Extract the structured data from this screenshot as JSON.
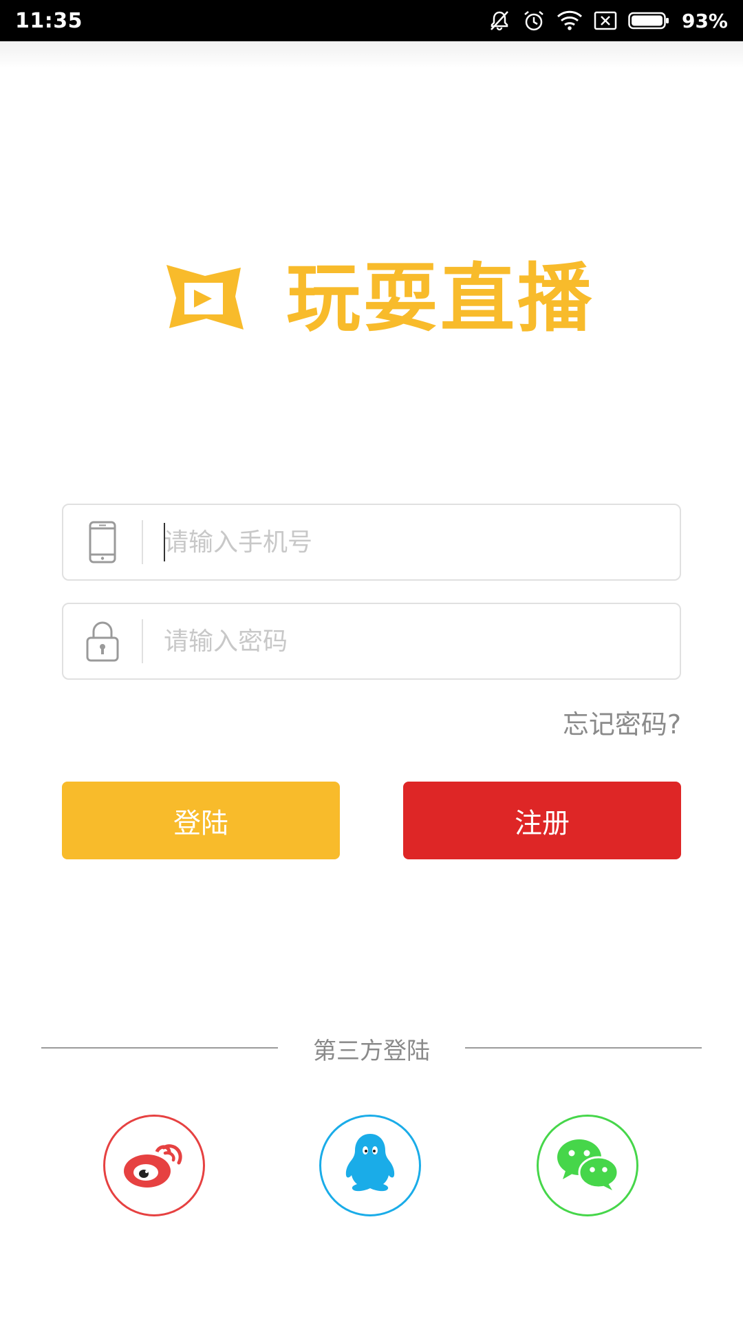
{
  "status_bar": {
    "time": "11:35",
    "battery_percent": "93%",
    "icons": [
      "bell-off-icon",
      "alarm-icon",
      "wifi-icon",
      "no-sim-icon",
      "battery-icon"
    ]
  },
  "logo": {
    "text": "玩耍直播",
    "icon": "play-frame-logo-icon",
    "color": "#F8BB2B"
  },
  "form": {
    "phone_placeholder": "请输入手机号",
    "phone_value": "",
    "password_placeholder": "请输入密码",
    "password_value": "",
    "forgot_label": "忘记密码?"
  },
  "buttons": {
    "login_label": "登陆",
    "register_label": "注册",
    "login_color": "#F8BB2B",
    "register_color": "#DE2626"
  },
  "third_party": {
    "title": "第三方登陆",
    "providers": [
      {
        "name": "weibo",
        "icon": "weibo-icon",
        "color": "#E64141"
      },
      {
        "name": "qq",
        "icon": "qq-icon",
        "color": "#1AACE8"
      },
      {
        "name": "wechat",
        "icon": "wechat-icon",
        "color": "#46D64A"
      }
    ]
  }
}
